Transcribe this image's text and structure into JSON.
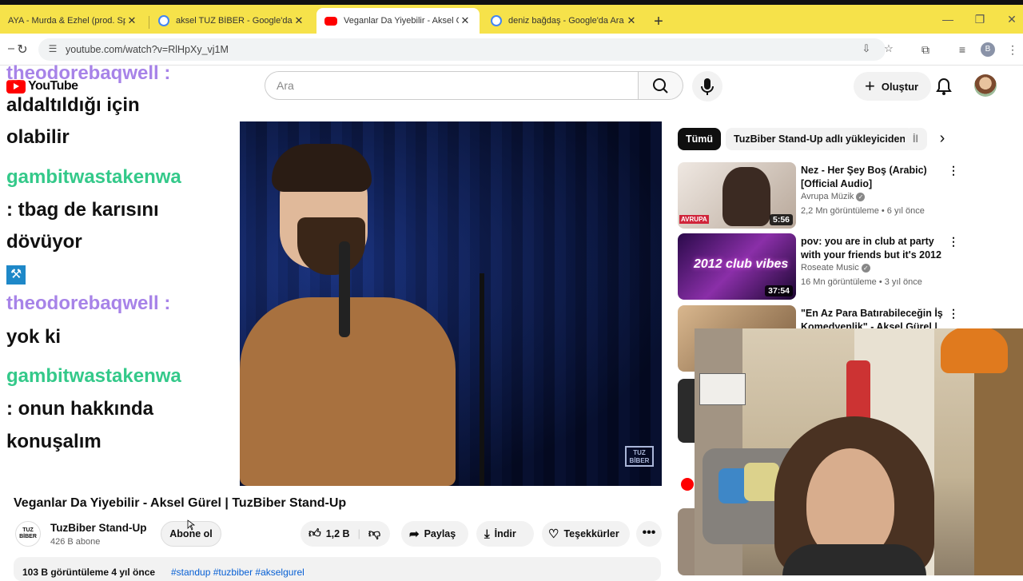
{
  "browser": {
    "tabs": [
      {
        "title": "AYA - Murda & Ezhel (prod. Spanker)",
        "favicon_color": "#f6e24a",
        "active": false
      },
      {
        "title": "aksel TUZ BİBER - Google'da Ara",
        "favicon_color": "#4285f4",
        "active": false
      },
      {
        "title": "Veganlar Da Yiyebilir - Aksel Gürel",
        "favicon_color": "#ff0000",
        "active": true
      },
      {
        "title": "deniz bağdaş - Google'da Ara",
        "favicon_color": "#4285f4",
        "active": false
      }
    ],
    "url": "youtube.com/watch?v=RlHpXy_vj1M",
    "profile_initial": "B"
  },
  "youtube": {
    "logo_text": "YouTube",
    "search_placeholder": "Ara",
    "create_label": "Oluştur"
  },
  "chat": [
    {
      "text": "theodorebaqwell :",
      "style": "user1"
    },
    {
      "text": "aldaltıldığı için",
      "style": "msg"
    },
    {
      "text": "olabilir",
      "style": "msg"
    },
    {
      "text": "gambitwastakenwa",
      "style": "user2"
    },
    {
      "text": ": tbag de karısını",
      "style": "msg"
    },
    {
      "text": "dövüyor",
      "style": "msg"
    },
    {
      "text": "theodorebaqwell :",
      "style": "user1"
    },
    {
      "text": "yok ki",
      "style": "msg"
    },
    {
      "text": "gambitwastakenwa",
      "style": "user2"
    },
    {
      "text": ": onun hakkında",
      "style": "msg"
    },
    {
      "text": "konuşalım",
      "style": "msg"
    }
  ],
  "video": {
    "watermark": "TUZ BİBER",
    "title": "Veganlar Da Yiyebilir - Aksel Gürel | TuzBiber Stand-Up",
    "channel_name": "TuzBiber Stand-Up",
    "channel_avatar_text": "TUZ BİBER",
    "subscribers": "426 B abone",
    "subscribe_label": "Abone ol",
    "likes": "1,2 B",
    "share_label": "Paylaş",
    "download_label": "İndir",
    "thanks_label": "Teşekkürler",
    "more_label": "•••",
    "stats": "103 B görüntüleme  4 yıl önce",
    "tags": "#standup #tuzbiber #akselgurel"
  },
  "chips": [
    {
      "label": "Tümü",
      "active": true
    },
    {
      "label": "TuzBiber Stand-Up adlı yükleyiciden",
      "active": false
    },
    {
      "label": "İl",
      "active": false
    }
  ],
  "recommendations": [
    {
      "title": "Nez - Her Şey Boş (Arabic) [Official Audio]",
      "channel": "Avrupa Müzik",
      "verified": true,
      "meta": "2,2 Mn görüntüleme • 6 yıl önce",
      "duration": "5:56",
      "thumb_color": "#d8d0c8",
      "thumb_label": "AVRUPA"
    },
    {
      "title": "pov: you are in club at party with your friends but it's 2012",
      "channel": "Roseate Music",
      "verified": true,
      "meta": "16 Mn görüntüleme • 3 yıl önce",
      "duration": "37:54",
      "thumb_color": "#5a1e78",
      "thumb_label": "2012 club vibes"
    },
    {
      "title": "\"En Az Para Batırabileceğin İş Komedyenlik\" - Aksel Gürel | ...",
      "channel": "",
      "verified": false,
      "meta": "",
      "duration": "",
      "thumb_color": "#c9a37a",
      "thumb_label": ""
    }
  ]
}
